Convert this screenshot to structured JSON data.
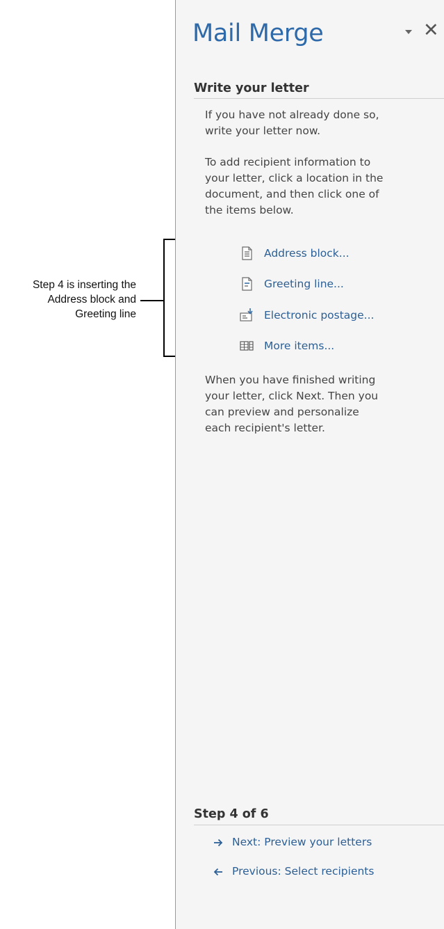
{
  "callout": {
    "lines": [
      "Step 4 is inserting the",
      "Address block and",
      "Greeting line"
    ]
  },
  "pane": {
    "title": "Mail Merge",
    "options_icon": "dropdown-triangle-icon",
    "close_icon": "close-icon",
    "close_glyph": "✕",
    "section_title": "Write your letter",
    "intro_lines": [
      "If you have not already done so,",
      "write your letter now."
    ],
    "instruction_lines": [
      "To add recipient information to",
      "your letter, click a location in the",
      "document, and then click one of",
      "the items below."
    ],
    "items": [
      {
        "label": "Address block...",
        "icon": "address-block-icon"
      },
      {
        "label": "Greeting line...",
        "icon": "greeting-line-icon"
      },
      {
        "label": "Electronic postage...",
        "icon": "electronic-postage-icon"
      },
      {
        "label": "More items...",
        "icon": "more-items-icon"
      }
    ],
    "finish_lines": [
      "When you have finished writing",
      "your letter, click Next. Then you",
      "can preview and personalize",
      "each recipient's letter."
    ],
    "step_label": "Step 4 of 6",
    "next_link": "Next: Preview your letters",
    "previous_link": "Previous: Select recipients",
    "colors": {
      "title": "#2e6aa9",
      "link": "#2b5f96",
      "text": "#444444",
      "pane_background": "#f5f5f5"
    }
  }
}
